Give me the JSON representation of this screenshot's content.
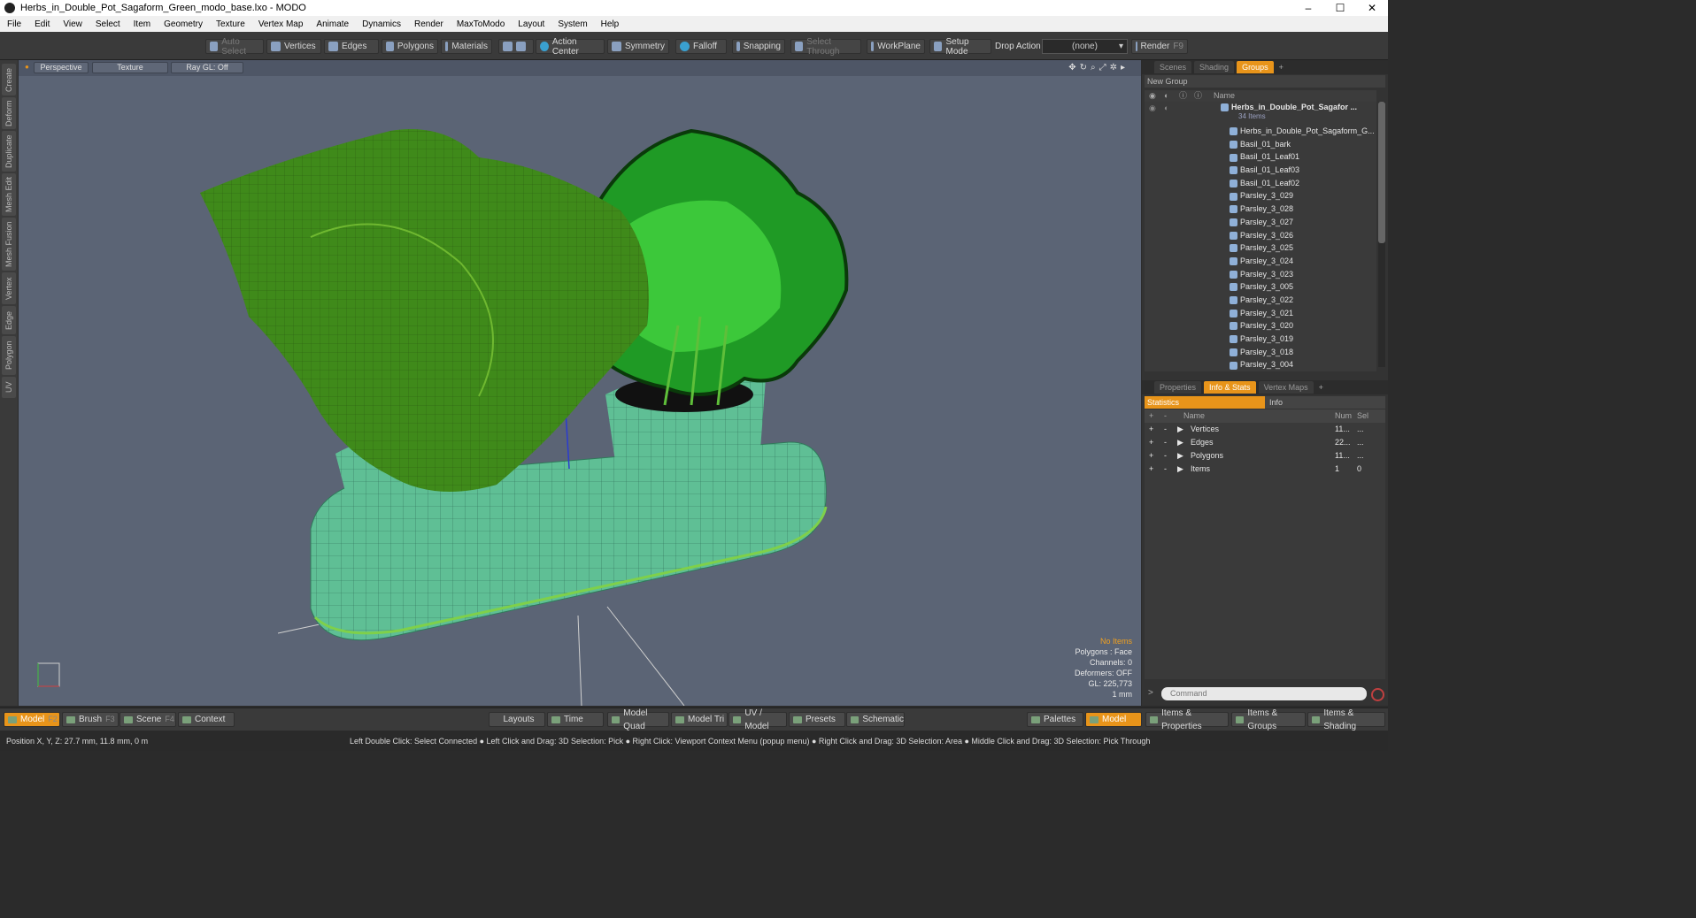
{
  "window": {
    "title": "Herbs_in_Double_Pot_Sagaform_Green_modo_base.lxo - MODO",
    "minimize": "–",
    "maximize": "☐",
    "close": "✕"
  },
  "menu": [
    "File",
    "Edit",
    "View",
    "Select",
    "Item",
    "Geometry",
    "Texture",
    "Vertex Map",
    "Animate",
    "Dynamics",
    "Render",
    "MaxToModo",
    "Layout",
    "System",
    "Help"
  ],
  "toolbar": {
    "auto_select": "Auto Select",
    "vertices": "Vertices",
    "edges": "Edges",
    "polygons": "Polygons",
    "materials": "Materials",
    "action_center": "Action Center",
    "symmetry": "Symmetry",
    "falloff": "Falloff",
    "snapping": "Snapping",
    "select_through": "Select Through",
    "workplane": "WorkPlane",
    "setup_mode": "Setup Mode",
    "drop_action": "Drop Action",
    "drop_value": "(none)",
    "render": "Render",
    "render_key": "F9"
  },
  "left_tabs": [
    "Create",
    "Deform",
    "Duplicate",
    "Mesh Edit",
    "Mesh Fusion",
    "Vertex",
    "Edge",
    "Polygon",
    "UV"
  ],
  "viewport": {
    "perspective": "Perspective",
    "texture": "Texture",
    "raygl": "Ray GL: Off",
    "overlay": {
      "no_items": "No Items",
      "polygons": "Polygons : Face",
      "channels": "Channels: 0",
      "deformers": "Deformers: OFF",
      "gl": "GL: 225,773",
      "scale": "1 mm"
    }
  },
  "top_panel": {
    "tabs": [
      "Scenes",
      "Shading",
      "Groups"
    ],
    "active_tab": "Groups",
    "add": "+",
    "new_group": "New Group",
    "name_header": "Name",
    "root": {
      "name": "Herbs_in_Double_Pot_Sagafor ...",
      "count": "34 Items"
    },
    "items": [
      "Herbs_in_Double_Pot_Sagaform_G...",
      "Basil_01_bark",
      "Basil_01_Leaf01",
      "Basil_01_Leaf03",
      "Basil_01_Leaf02",
      "Parsley_3_029",
      "Parsley_3_028",
      "Parsley_3_027",
      "Parsley_3_026",
      "Parsley_3_025",
      "Parsley_3_024",
      "Parsley_3_023",
      "Parsley_3_005",
      "Parsley_3_022",
      "Parsley_3_021",
      "Parsley_3_020",
      "Parsley_3_019",
      "Parsley_3_018",
      "Parsley_3_004"
    ]
  },
  "bottom_panel": {
    "tabs": [
      "Properties",
      "Info & Stats",
      "Vertex Maps"
    ],
    "active_tab": "Info & Stats",
    "add": "+",
    "sub_tabs": [
      "Statistics",
      "Info"
    ],
    "headers": {
      "name": "Name",
      "num": "Num",
      "sel": "Sel"
    },
    "rows": [
      {
        "plus": "+",
        "minus": "-",
        "name": "Vertices",
        "num": "11...",
        "sel": "..."
      },
      {
        "plus": "+",
        "minus": "-",
        "name": "Edges",
        "num": "22...",
        "sel": "..."
      },
      {
        "plus": "+",
        "minus": "-",
        "name": "Polygons",
        "num": "11...",
        "sel": "..."
      },
      {
        "plus": "+",
        "minus": "-",
        "name": "Items",
        "num": "1",
        "sel": "0"
      }
    ],
    "command_placeholder": "Command"
  },
  "bottom_bar": {
    "model": "Model",
    "model_key": "F2",
    "brush": "Brush",
    "brush_key": "F3",
    "scene": "Scene",
    "scene_key": "F4",
    "context": "Context",
    "layouts": "Layouts",
    "time": "Time",
    "model_quad": "Model Quad",
    "model_tri": "Model Tri",
    "uv_model": "UV / Model",
    "presets": "Presets",
    "schematic": "Schematic",
    "palettes": "Palettes",
    "model2": "Model",
    "items_properties": "Items & Properties",
    "items_groups": "Items & Groups",
    "items_shading": "Items & Shading"
  },
  "status": {
    "position": "Position X, Y, Z:   27.7 mm, 11.8 mm, 0 m",
    "hints": "Left Double Click: Select Connected ● Left Click and Drag: 3D Selection: Pick ● Right Click: Viewport Context Menu (popup menu) ● Right Click and Drag: 3D Selection: Area ● Middle Click and Drag: 3D Selection: Pick Through"
  },
  "colors": {
    "accent": "#e8941a",
    "viewport_bg": "#5b6475",
    "pot": "#5fbf95",
    "basil": "#3f8a1a",
    "parsley": "#1f9a25"
  }
}
